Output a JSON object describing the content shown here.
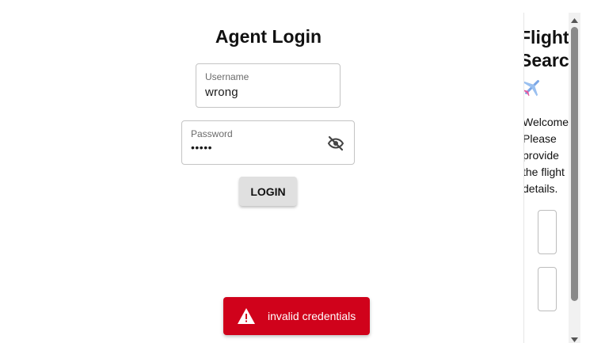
{
  "login": {
    "title": "Agent Login",
    "username_label": "Username",
    "username_value": "wrong",
    "password_label": "Password",
    "password_value": "•••••",
    "login_button": "LOGIN"
  },
  "toast": {
    "message": "invalid credentials",
    "color": "#d0021b",
    "icon": "warning-icon"
  },
  "flight_panel": {
    "title_line1": "Flight",
    "title_line2": "Search",
    "icon": "airplane-icon",
    "welcome_lines": [
      "Welcome",
      "Please",
      "provide",
      "the flight",
      "details."
    ]
  },
  "icons": {
    "password_toggle": "eye-off-icon"
  }
}
